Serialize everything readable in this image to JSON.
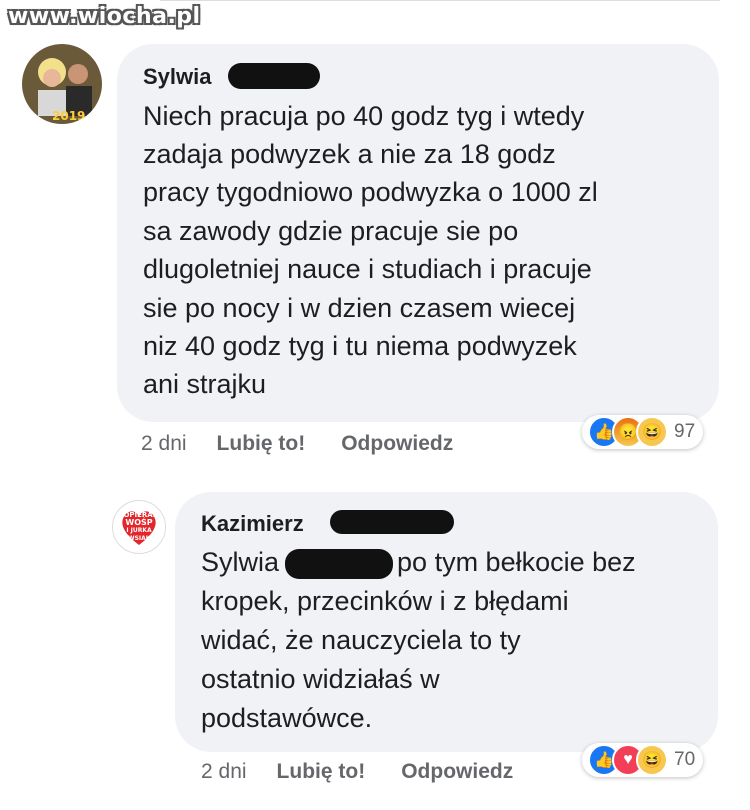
{
  "watermark": "www.wiocha.pl",
  "comments": [
    {
      "author": "Sylwia",
      "text_lines": [
        "Niech pracuja po 40 godz tyg i wtedy",
        "zadaja podwyzek a nie za 18 godz",
        "pracy tygodniowo podwyzka o 1000 zl",
        "sa zawody gdzie pracuje sie po",
        "dlugoletniej nauce i studiach i pracuje",
        "sie po nocy i w dzien czasem wiecej",
        "niz 40 godz tyg i tu niema podwyzek",
        "ani strajku"
      ],
      "time": "2 dni",
      "like_label": "Lubię to!",
      "reply_label": "Odpowiedz",
      "reaction_icons": [
        "like-icon",
        "angry-icon",
        "haha-icon"
      ],
      "reaction_count": "97"
    },
    {
      "author": "Kazimierz",
      "text_lines": [
        "Sylwia",
        "kropek, przecinków i z błędami",
        "widać, że nauczyciela to ty",
        "ostatnio widziałaś w",
        "podstawówce."
      ],
      "text_line1_tail": "po tym bełkocie bez",
      "time": "2 dni",
      "like_label": "Lubię to!",
      "reply_label": "Odpowiedz",
      "reaction_icons": [
        "like-icon",
        "love-icon",
        "haha-icon"
      ],
      "reaction_count": "70",
      "avatar_text": [
        "POPIERAM",
        "WOŚP",
        "I JURKA",
        "OWSIAKA"
      ]
    }
  ],
  "colors": {
    "bubble": "#f0f2f5",
    "meta_text": "#65676b",
    "like_blue": "#1877f2",
    "love_red": "#f33e58",
    "haha_yellow": "#f7c74f"
  }
}
